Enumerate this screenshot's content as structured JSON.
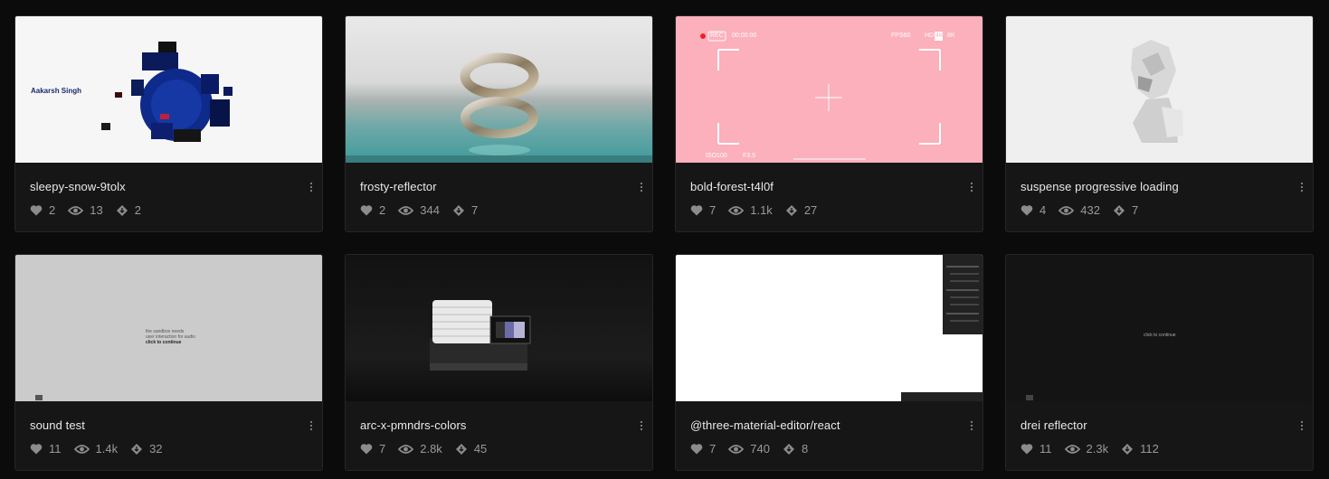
{
  "cards": [
    {
      "title": "sleepy-snow-9tolx",
      "likes": "2",
      "views": "13",
      "forks": "2",
      "thumb_text": "Aakarsh Singh"
    },
    {
      "title": "frosty-reflector",
      "likes": "2",
      "views": "344",
      "forks": "7"
    },
    {
      "title": "bold-forest-t4l0f",
      "likes": "7",
      "views": "1.1k",
      "forks": "27",
      "hud": {
        "rec": "REC",
        "time": "00:00:00",
        "fps": "FPS60",
        "hd": "HD",
        "hd_res": "4K",
        "res2": "8K",
        "iso": "ISO100",
        "fstop": "F3.5"
      }
    },
    {
      "title": "suspense progressive loading",
      "likes": "4",
      "views": "432",
      "forks": "7"
    },
    {
      "title": "sound test",
      "likes": "11",
      "views": "1.4k",
      "forks": "32",
      "thumb_lines": [
        "the sandbox needs",
        "user interaction for audio",
        "click to continue"
      ]
    },
    {
      "title": "arc-x-pmndrs-colors",
      "likes": "7",
      "views": "2.8k",
      "forks": "45"
    },
    {
      "title": "@three-material-editor/react",
      "likes": "7",
      "views": "740",
      "forks": "8"
    },
    {
      "title": "drei reflector",
      "likes": "11",
      "views": "2.3k",
      "forks": "112",
      "thumb_text": "click to continue"
    }
  ],
  "colors": {
    "page_bg": "#0b0b0b",
    "card_bg": "#161616",
    "muted": "#9a9a9a",
    "pink": "#fbb0bc"
  },
  "icons": {
    "likes": "heart-icon",
    "views": "eye-icon",
    "forks": "fork-icon",
    "menu": "more-vertical-icon"
  }
}
